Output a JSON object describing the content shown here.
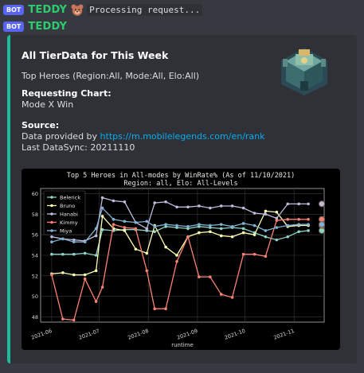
{
  "header": {
    "bot_tag": "BOT",
    "username": "TEDDY",
    "status_text": "Processing request..."
  },
  "reply": {
    "bot_tag": "BOT",
    "username": "TEDDY"
  },
  "embed": {
    "accent_color": "#1abc9c",
    "title": "All TierData for This Week",
    "description": "Top Heroes (Region:All, Mode:All, Elo:All)",
    "chart_field_name": "Requesting Chart:",
    "chart_field_value": "Mode X Win",
    "source_field_name": "Source:",
    "source_prefix": "Data provided by ",
    "source_link": "https://m.mobilelegends.com/en/rank",
    "last_sync": "Last DataSync: 20211110",
    "thumbnail_icon": "castle-thumbnail"
  },
  "chart_data": {
    "type": "line",
    "title": "Top 5 Heroes in All-modes by WinRate% (As of 11/10/2021)",
    "subtitle": "Region: all, Elo: All-Levels",
    "xlabel": "runtime",
    "ylabel": "",
    "ylim": [
      47.5,
      60.5
    ],
    "yticks": [
      "48",
      "50",
      "52",
      "54",
      "56",
      "58",
      "60"
    ],
    "xticks": [
      "2021-06",
      "2021-07",
      "2021-08",
      "2021-09",
      "2021-10",
      "2021-11"
    ],
    "legend_position": "top-left",
    "grid": true,
    "x": [
      "2021-06-01",
      "2021-06-08",
      "2021-06-15",
      "2021-06-22",
      "2021-06-29",
      "2021-07-03",
      "2021-07-10",
      "2021-07-17",
      "2021-07-24",
      "2021-07-31",
      "2021-08-05",
      "2021-08-12",
      "2021-08-19",
      "2021-08-26",
      "2021-09-02",
      "2021-09-09",
      "2021-09-16",
      "2021-09-23",
      "2021-09-30",
      "2021-10-07",
      "2021-10-14",
      "2021-10-21",
      "2021-10-28",
      "2021-11-04",
      "2021-11-10"
    ],
    "series": [
      {
        "name": "Belerick",
        "color": "#8dd3c7",
        "values": [
          54.1,
          54.1,
          54.1,
          54.2,
          54.0,
          56.5,
          56.4,
          56.5,
          56.5,
          56.4,
          56.3,
          56.8,
          56.7,
          56.6,
          56.8,
          56.7,
          56.6,
          56.7,
          56.6,
          56.2,
          55.8,
          55.5,
          55.8,
          56.3,
          56.4
        ]
      },
      {
        "name": "Bruno",
        "color": "#feffb3",
        "values": [
          52.2,
          52.3,
          52.1,
          52.1,
          52.5,
          57.8,
          56.6,
          56.4,
          54.6,
          54.2,
          56.9,
          54.8,
          54.0,
          55.8,
          56.2,
          56.3,
          55.9,
          55.8,
          56.2,
          56.0,
          58.3,
          58.2,
          56.8,
          56.9,
          56.9
        ]
      },
      {
        "name": "Hanabi",
        "color": "#bebada",
        "values": [
          55.8,
          55.6,
          55.5,
          55.4,
          55.9,
          59.6,
          59.3,
          59.2,
          57.2,
          56.6,
          59.1,
          59.2,
          58.7,
          58.7,
          58.8,
          58.6,
          58.8,
          58.8,
          58.6,
          58.1,
          58.0,
          57.6,
          59.0,
          59.0,
          59.0
        ]
      },
      {
        "name": "Kimmy",
        "color": "#fa8174",
        "values": [
          52.1,
          47.8,
          47.7,
          51.7,
          49.5,
          50.9,
          57.0,
          56.7,
          56.6,
          52.5,
          48.8,
          48.8,
          53.4,
          55.8,
          51.9,
          51.9,
          50.2,
          49.9,
          54.1,
          54.1,
          53.9,
          57.4,
          57.5,
          57.5,
          57.5
        ]
      },
      {
        "name": "Miya",
        "color": "#81b1d2",
        "values": [
          55.3,
          55.6,
          55.3,
          55.3,
          56.6,
          58.6,
          57.5,
          57.3,
          57.2,
          57.3,
          56.8,
          57.0,
          56.9,
          56.8,
          57.0,
          56.9,
          57.0,
          56.8,
          57.1,
          56.9,
          56.4,
          56.7,
          56.9,
          57.0,
          57.0
        ]
      }
    ]
  }
}
